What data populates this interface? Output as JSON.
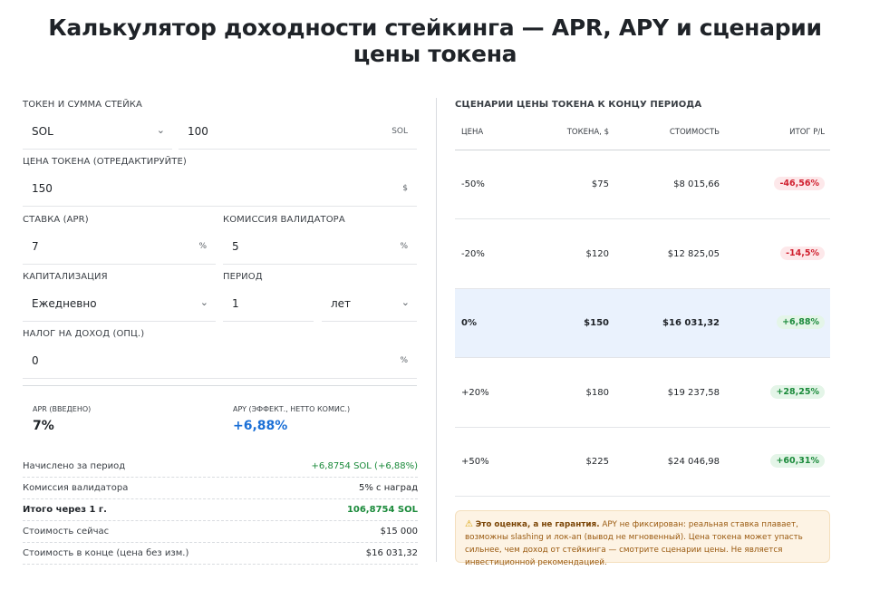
{
  "title": "Калькулятор доходности стейкинга — APR, APY и сценарии цены токена",
  "form": {
    "token_amount": {
      "label": "Токен и сумма стейка",
      "token": "SOL",
      "amount": "100",
      "unit": "SOL"
    },
    "price": {
      "label": "Цена токена (отредактируйте)",
      "value": "150",
      "unit": "$"
    },
    "apr": {
      "label": "Ставка (APR)",
      "value": "7",
      "unit": "%"
    },
    "fee": {
      "label": "Комиссия валидатора",
      "value": "5",
      "unit": "%"
    },
    "compounding": {
      "label": "Капитализация",
      "value": "Ежедневно"
    },
    "period": {
      "label": "Период",
      "value": "1",
      "unit": "лет"
    },
    "tax": {
      "label": "Налог на доход (опц.)",
      "value": "0",
      "unit": "%"
    }
  },
  "metrics": {
    "apr": {
      "label": "APR (введено)",
      "value": "7%"
    },
    "apy": {
      "label": "APY (эффект., нетто комис.)",
      "value": "+6,88%",
      "color": "#1a6fd6"
    }
  },
  "summary": [
    {
      "key": "Начислено за период",
      "value": "+6,8754 SOL (+6,88%)",
      "style": "green"
    },
    {
      "key": "Комиссия валидатора",
      "value": "5% с наград",
      "style": ""
    },
    {
      "key": "Итого через 1 г.",
      "value": "106,8754 SOL",
      "style": "total"
    },
    {
      "key": "Стоимость сейчас",
      "value": "$15 000",
      "style": ""
    },
    {
      "key": "Стоимость в конце (цена без изм.)",
      "value": "$16 031,32",
      "style": ""
    }
  ],
  "scenarios": {
    "title": "Сценарии цены токена к концу периода",
    "columns": [
      "Цена",
      "Токена, $",
      "Стоимость",
      "Итог P/L"
    ],
    "rows": [
      {
        "change": "-50%",
        "price": "$75",
        "value": "$8 015,66",
        "pl": "-46,56%",
        "sign": "neg",
        "highlight": false
      },
      {
        "change": "-20%",
        "price": "$120",
        "value": "$12 825,05",
        "pl": "-14,5%",
        "sign": "neg",
        "highlight": false
      },
      {
        "change": "0%",
        "price": "$150",
        "value": "$16 031,32",
        "pl": "+6,88%",
        "sign": "pos",
        "highlight": true
      },
      {
        "change": "+20%",
        "price": "$180",
        "value": "$19 237,58",
        "pl": "+28,25%",
        "sign": "pos",
        "highlight": false
      },
      {
        "change": "+50%",
        "price": "$225",
        "value": "$24 046,98",
        "pl": "+60,31%",
        "sign": "pos",
        "highlight": false
      }
    ]
  },
  "note": {
    "icon": "warning-icon",
    "bold": "Это оценка, а не гарантия.",
    "text": "APY не фиксирован: реальная ставка плавает, возможны slashing и лок-ап (вывод не мгновенный). Цена токена может упасть сильнее, чем доход от стейкинга — смотрите сценарии цены. Не является инвестиционной рекомендацией."
  },
  "colors": {
    "green": "#1a8a3a",
    "red": "#d0202f",
    "blue": "#1a6fd6",
    "highlight_row": "#eaf2fd",
    "note_bg": "#fdf3e4"
  }
}
